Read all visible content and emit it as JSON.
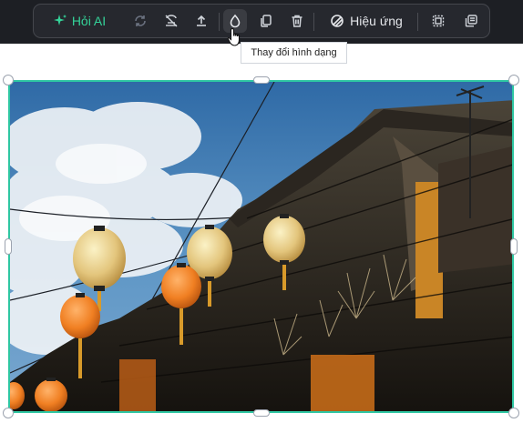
{
  "toolbar": {
    "ai_label": "Hỏi AI",
    "effects_label": "Hiệu ứng",
    "icons": [
      "sparkle-icon",
      "regenerate-icon",
      "remove-background-icon",
      "upload-icon",
      "shape-drop-icon",
      "duplicate-icon",
      "delete-icon",
      "effects-icon",
      "crop-icon",
      "layer-icon"
    ]
  },
  "tooltip": {
    "text": "Thay đổi hình dạng"
  },
  "colors": {
    "accent": "#2fc7a3",
    "ai_green": "#34d399",
    "toolbar_bg": "#26282e",
    "page_top": "#1d1f24"
  },
  "image": {
    "subject": "lanterns-old-street-photo"
  }
}
